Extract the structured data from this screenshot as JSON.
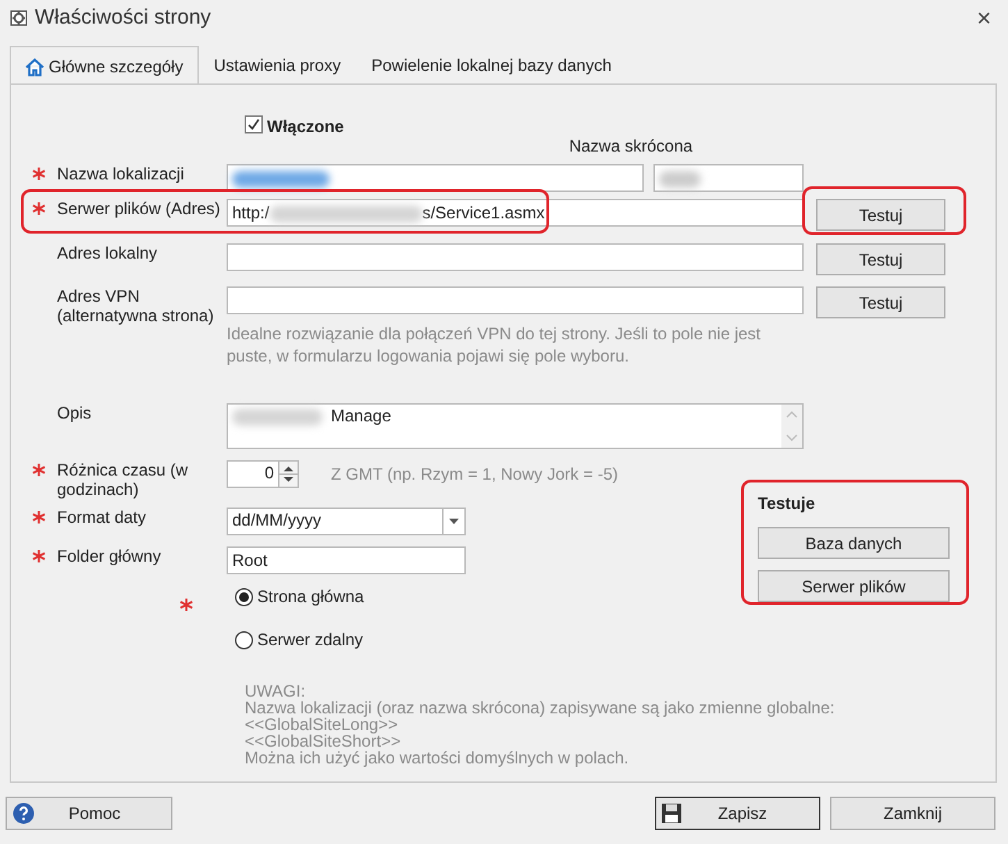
{
  "window": {
    "title": "Właściwości strony",
    "close": "×"
  },
  "tabs": [
    {
      "label": "Główne szczegóły",
      "kind": "home",
      "selected": true
    },
    {
      "label": "Ustawienia proxy",
      "kind": "plain",
      "selected": false
    },
    {
      "label": "Powielenie lokalnej bazy danych",
      "kind": "plain",
      "selected": false
    }
  ],
  "enabled": {
    "label": "Włączone",
    "checked": true
  },
  "short_name_label": "Nazwa skrócona",
  "rows": [
    {
      "kind": "name",
      "label": "Nazwa lokalizacji",
      "required": true
    },
    {
      "kind": "url",
      "label": "Serwer plików (Adres)",
      "required": true,
      "value_start": "http:/",
      "value_end": "s/Service1.asmx",
      "button": "Testuj",
      "highlighted": true
    },
    {
      "kind": "url",
      "label": "Adres lokalny",
      "required": false,
      "button": "Testuj",
      "highlighted": false
    },
    {
      "kind": "url",
      "label": "Adres VPN (alternatywna strona)",
      "required": false,
      "button": "Testuj",
      "highlighted": false,
      "hint": "Idealne rozwiązanie dla połączeń VPN do tej strony. Jeśli to pole nie jest puste, w formularzu logowania pojawi się pole wyboru."
    },
    {
      "kind": "memo",
      "label": "Opis",
      "required": false,
      "value": "Manage"
    },
    {
      "kind": "spin",
      "label": "Różnica czasu (w godzinach)",
      "required": true,
      "value": "0",
      "hint": "Z GMT (np. Rzym = 1, Nowy Jork = -5)"
    },
    {
      "kind": "combo",
      "label": "Format daty",
      "required": true,
      "value": "dd/MM/yyyy"
    },
    {
      "kind": "text",
      "label": "Folder główny",
      "required": true,
      "value": "Root"
    },
    {
      "kind": "radio",
      "required": true,
      "options": [
        {
          "label": "Strona główna",
          "selected": true
        },
        {
          "label": "Serwer zdalny",
          "selected": false
        }
      ]
    }
  ],
  "test_group": {
    "title": "Testuje",
    "buttons": [
      "Baza danych",
      "Serwer plików"
    ],
    "highlighted": true
  },
  "notes": [
    "UWAGI:",
    "Nazwa lokalizacji (oraz nazwa skrócona) zapisywane są jako zmienne globalne:",
    "<<GlobalSiteLong>>",
    "<<GlobalSiteShort>>",
    "Można ich użyć jako wartości domyślnych w polach."
  ],
  "footer": {
    "help": "Pomoc",
    "save": "Zapisz",
    "close": "Zamknij"
  }
}
